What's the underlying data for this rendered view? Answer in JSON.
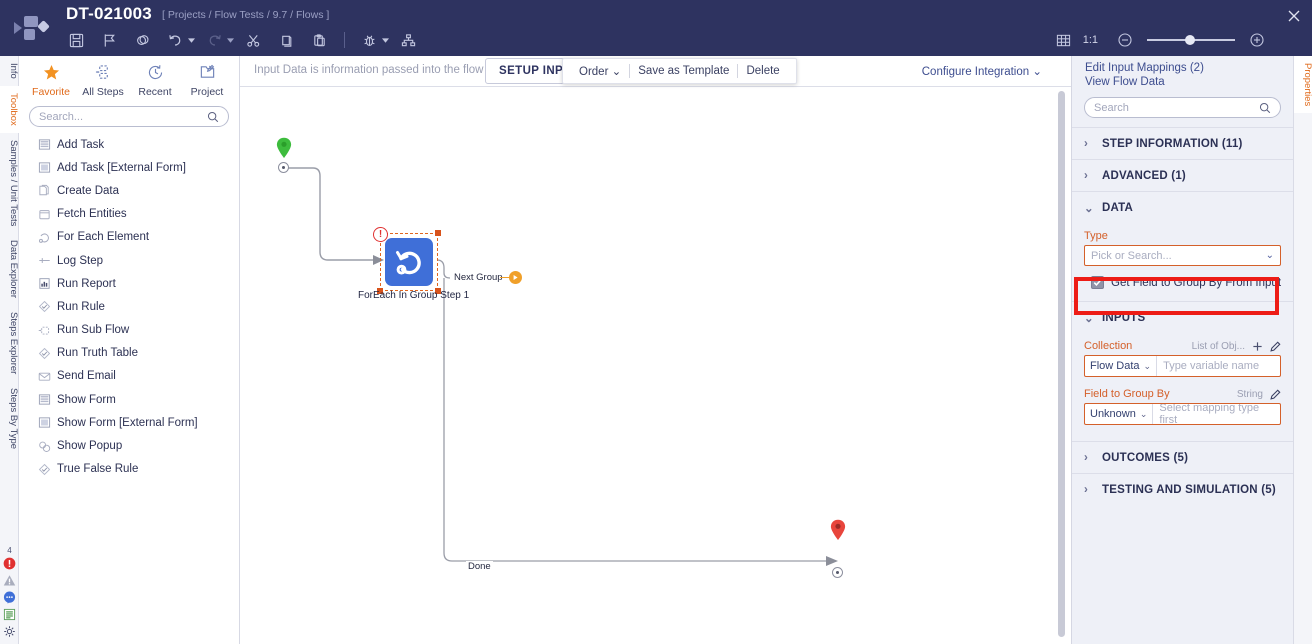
{
  "topbar": {
    "title": "DT-021003",
    "breadcrumb": "[ Projects / Flow Tests / 9.7 / Flows ]",
    "icons": [
      {
        "name": "save-icon",
        "label": "Save"
      },
      {
        "name": "flag-icon",
        "label": "Flag"
      },
      {
        "name": "rings-icon",
        "label": "Validation"
      },
      {
        "name": "undo-icon",
        "label": "Undo"
      },
      {
        "name": "redo-icon",
        "label": "Redo"
      },
      {
        "name": "scissors-icon",
        "label": "Cut"
      },
      {
        "name": "copy-icon",
        "label": "Copy"
      },
      {
        "name": "paste-icon",
        "label": "Paste"
      },
      {
        "name": "debug-bug-icon",
        "label": "Debug"
      },
      {
        "name": "hierarchy-icon",
        "label": "Hierarchy"
      }
    ],
    "zoom": {
      "grid_label": "grid-icon",
      "fit_label": "1:1",
      "zoom_out": "−",
      "zoom_in": "+",
      "slider_value": 45
    },
    "close_label": "×"
  },
  "left_rail": {
    "tabs": [
      {
        "label": "Info",
        "active": false
      },
      {
        "label": "Toolbox",
        "active": true
      },
      {
        "label": "Samples / Unit Tests",
        "active": false
      },
      {
        "label": "Data Explorer",
        "active": false
      },
      {
        "label": "Steps Explorer",
        "active": false
      },
      {
        "label": "Steps By Type",
        "active": false
      }
    ],
    "status": {
      "error_count": "4",
      "icons": [
        {
          "name": "error-icon"
        },
        {
          "name": "warning-icon"
        },
        {
          "name": "comment-icon"
        },
        {
          "name": "notes-icon"
        },
        {
          "name": "settings-gear-icon"
        }
      ]
    }
  },
  "toolbox": {
    "tabs": [
      {
        "label": "Favorite",
        "icon": "star-icon",
        "active": true
      },
      {
        "label": "All Steps",
        "icon": "all-steps-icon",
        "active": false
      },
      {
        "label": "Recent",
        "icon": "clock-icon",
        "active": false
      },
      {
        "label": "Project",
        "icon": "project-icon",
        "active": false
      }
    ],
    "search_placeholder": "Search...",
    "search_value": "",
    "steps": [
      {
        "label": "Add Task",
        "icon": "form-lines-icon"
      },
      {
        "label": "Add Task [External Form]",
        "icon": "external-form-icon"
      },
      {
        "label": "Create Data",
        "icon": "pages-icon"
      },
      {
        "label": "Fetch Entities",
        "icon": "box-icon"
      },
      {
        "label": "For Each Element",
        "icon": "loop-icon"
      },
      {
        "label": "Log Step",
        "icon": "log-icon"
      },
      {
        "label": "Run Report",
        "icon": "report-icon"
      },
      {
        "label": "Run Rule",
        "icon": "check-diamond-icon"
      },
      {
        "label": "Run Sub Flow",
        "icon": "subflow-icon"
      },
      {
        "label": "Run Truth Table",
        "icon": "check-diamond-icon"
      },
      {
        "label": "Send Email",
        "icon": "envelope-icon"
      },
      {
        "label": "Show Form",
        "icon": "form-lines-icon"
      },
      {
        "label": "Show Form [External Form]",
        "icon": "external-form-icon"
      },
      {
        "label": "Show Popup",
        "icon": "popup-icon"
      },
      {
        "label": "True False Rule",
        "icon": "check-diamond-icon"
      }
    ]
  },
  "canvas_header": {
    "hint": "Input Data is information passed into the flow",
    "setup_button": "SETUP INPUT DATA",
    "integration_button": "Configure Integration",
    "context_menu": [
      {
        "label": "Order",
        "has_caret": true
      },
      {
        "label": "Save as Template",
        "has_caret": false
      },
      {
        "label": "Delete",
        "has_caret": false
      }
    ]
  },
  "flow": {
    "start_node": {
      "name": "start-pin",
      "color": "#3dbc3d"
    },
    "end_node": {
      "name": "end-pin",
      "color": "#e8453c"
    },
    "step": {
      "label": "ForEach In Group Step 1",
      "icon": "loop-step-icon",
      "color": "#3f6fd8",
      "selected": true,
      "error_badge": "!"
    },
    "edges": [
      {
        "label": "Next  Group"
      },
      {
        "label": "Done"
      }
    ]
  },
  "right_rail": {
    "tabs": [
      {
        "label": "Properties",
        "active": true
      }
    ]
  },
  "properties": {
    "links": [
      {
        "label": "Edit Input Mappings (2)"
      },
      {
        "label": "View Flow Data"
      }
    ],
    "search_placeholder": "Search",
    "search_value": "",
    "sections": [
      {
        "label": "STEP INFORMATION (11)",
        "expanded": false
      },
      {
        "label": "ADVANCED (1)",
        "expanded": false
      },
      {
        "label": "DATA",
        "expanded": true
      },
      {
        "label": "INPUTS",
        "expanded": true
      },
      {
        "label": "OUTCOMES (5)",
        "expanded": false
      },
      {
        "label": "TESTING AND SIMULATION (5)",
        "expanded": false
      }
    ],
    "data": {
      "type_label": "Type",
      "type_placeholder": "Pick or Search...",
      "type_value": "",
      "checkbox": {
        "label": "Get Field to Group By From Input",
        "checked": true,
        "highlight_color": "#ed1c16"
      }
    },
    "inputs": {
      "collection": {
        "label": "Collection",
        "type_hint": "List of Obj...",
        "mapping_type": "Flow Data",
        "placeholder": "Type variable name",
        "value": "",
        "actions": [
          "plus-icon",
          "pencil-icon"
        ]
      },
      "field_to_group_by": {
        "label": "Field to Group By",
        "type_hint": "String",
        "mapping_type": "Unknown",
        "placeholder": "Select mapping type first",
        "value": "",
        "actions": [
          "pencil-icon"
        ]
      }
    }
  }
}
